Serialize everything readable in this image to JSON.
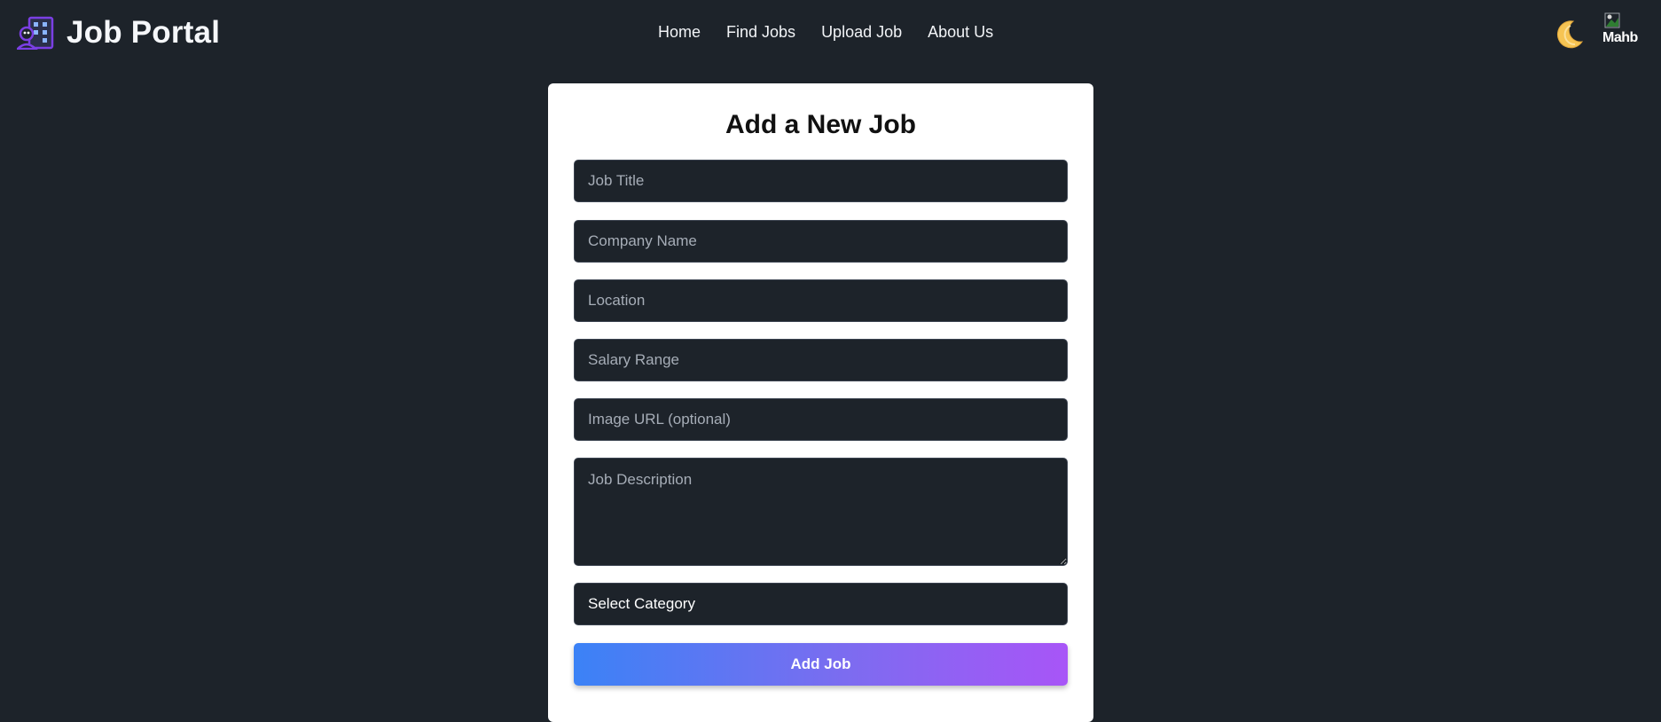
{
  "nav": {
    "brand_title": "Job Portal",
    "brand_logo_icon": "job-portal-building-icon",
    "links": [
      "Home",
      "Find Jobs",
      "Upload Job",
      "About Us"
    ],
    "theme_icon": "moon-icon",
    "avatar_alt_text": "Mahb"
  },
  "form": {
    "title": "Add a New Job",
    "job_title_placeholder": "Job Title",
    "company_placeholder": "Company Name",
    "location_placeholder": "Location",
    "salary_placeholder": "Salary Range",
    "image_url_placeholder": "Image URL (optional)",
    "description_placeholder": "Job Description",
    "category_selected": "Select Category",
    "submit_label": "Add Job"
  },
  "colors": {
    "background": "#1d232a",
    "card": "#ffffff",
    "gradient_start": "#3b82f6",
    "gradient_end": "#a855f7",
    "logo_purple": "#7b3fe4"
  }
}
